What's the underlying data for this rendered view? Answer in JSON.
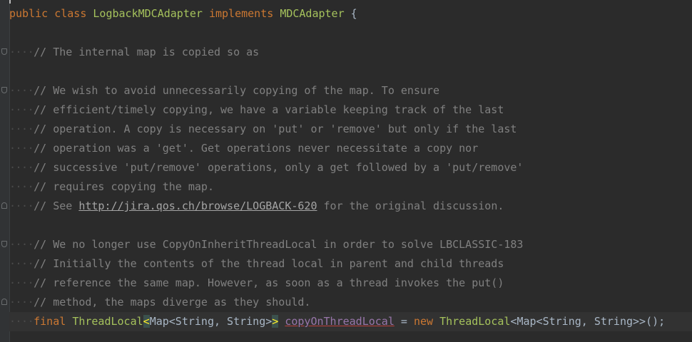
{
  "code": {
    "class_decl": {
      "kw_public": "public",
      "kw_class": "class",
      "class_name": "LogbackMDCAdapter",
      "kw_implements": "implements",
      "interface_name": "MDCAdapter",
      "brace": "{"
    },
    "indent_guide": "····",
    "comment_block_1": [
      "// The internal map is copied so as"
    ],
    "comment_block_2": [
      "// We wish to avoid unnecessarily copying of the map. To ensure",
      "// efficient/timely copying, we have a variable keeping track of the last",
      "// operation. A copy is necessary on 'put' or 'remove' but only if the last",
      "// operation was a 'get'. Get operations never necessitate a copy nor",
      "// successive 'put/remove' operations, only a get followed by a 'put/remove'",
      "// requires copying the map."
    ],
    "see_line": {
      "prefix": "// See ",
      "url": "http://jira.qos.ch/browse/LOGBACK-620",
      "suffix": " for the original discussion."
    },
    "comment_block_3": [
      "// We no longer use CopyOnInheritThreadLocal in order to solve LBCLASSIC-183",
      "// Initially the contents of the thread local in parent and child threads",
      "// reference the same map. However, as soon as a thread invokes the put()",
      "// method, the maps diverge as they should."
    ],
    "field_decl": {
      "kw_final": "final",
      "type_name": "ThreadLocal",
      "lt1": "<",
      "generic_type": "Map<String, String>",
      "gt1": ">",
      "field_name": "copyOnThreadLocal",
      "assign": " = ",
      "kw_new": "new",
      "new_type": "ThreadLocal",
      "new_generic": "<Map<String, String>>",
      "tail": "();"
    }
  }
}
